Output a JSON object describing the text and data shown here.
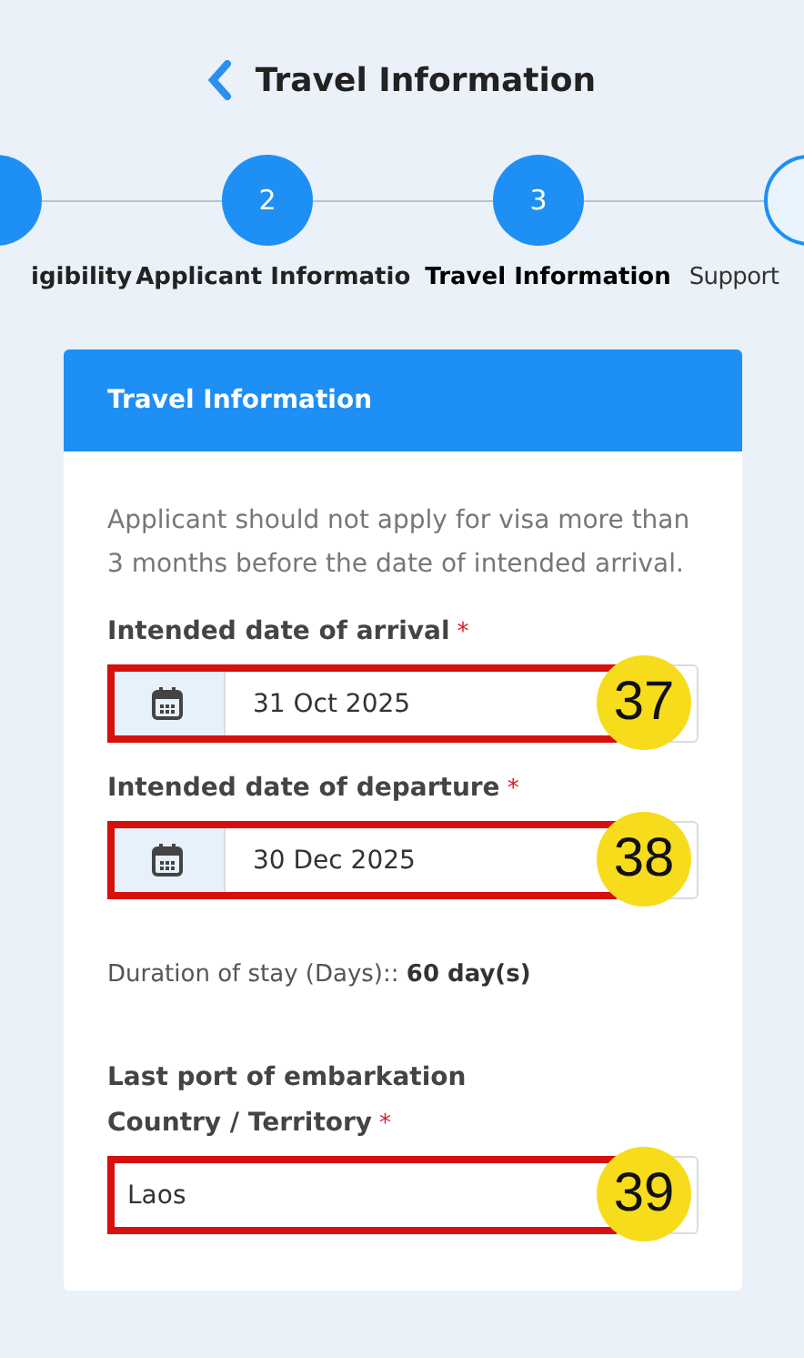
{
  "header": {
    "title": "Travel Information"
  },
  "steps": [
    {
      "label": "igibility",
      "filled": true,
      "selected": false
    },
    {
      "number": "2",
      "label": "Applicant Informatio",
      "filled": true,
      "selected": false
    },
    {
      "number": "3",
      "label": "Travel Information",
      "filled": true,
      "selected": true
    },
    {
      "label": "Support",
      "filled": false,
      "selected": false
    }
  ],
  "card": {
    "title": "Travel Information",
    "notice": "Applicant should not apply for visa more than 3 months before the date of intended arrival.",
    "fields": [
      {
        "kind": "date",
        "label": "Intended date of arrival",
        "required_mark": "*",
        "value": "31 Oct 2025",
        "marker": "37"
      },
      {
        "kind": "date",
        "label": "Intended date of departure",
        "required_mark": "*",
        "value": "30 Dec 2025",
        "marker": "38"
      },
      {
        "kind": "info",
        "label": "Duration of stay (Days)::",
        "value": "60 day(s)"
      },
      {
        "kind": "text",
        "label": "Last port of embarkation",
        "sublabel": "Country / Territory",
        "required_mark": "*",
        "value": "Laos",
        "marker": "39"
      }
    ]
  }
}
